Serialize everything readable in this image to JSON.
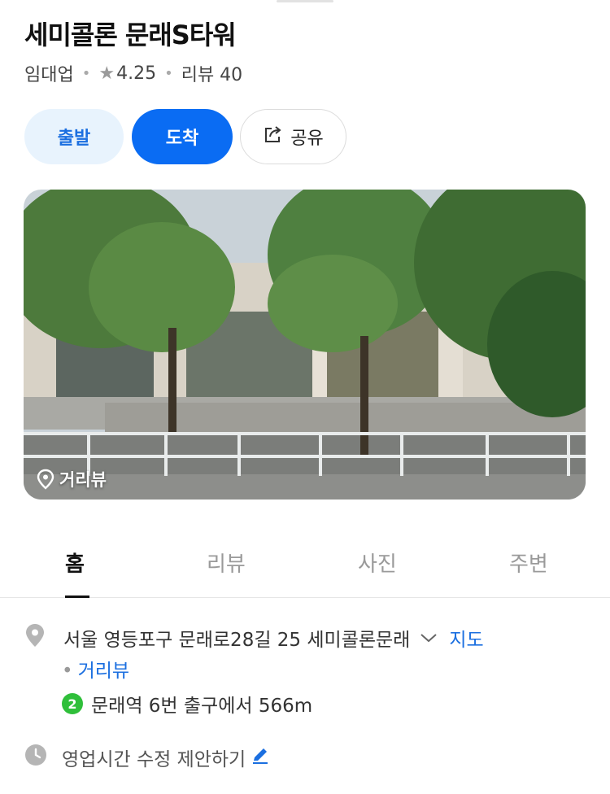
{
  "place": {
    "name": "세미콜론 문래S타워",
    "category": "임대업",
    "rating": "4.25",
    "reviews": "리뷰 40"
  },
  "actions": {
    "depart": "출발",
    "arrive": "도착",
    "share": "공유"
  },
  "photo": {
    "streetview_label": "거리뷰"
  },
  "tabs": [
    "홈",
    "리뷰",
    "사진",
    "주변"
  ],
  "info": {
    "address": "서울 영등포구 문래로28길 25 세미콜론문래",
    "map_link": "지도",
    "streetview_link": "거리뷰",
    "subway_line": "2",
    "subway_text": "문래역 6번 출구에서 566m",
    "hours_suggest": "영업시간 수정 제안하기"
  },
  "colors": {
    "primary": "#0a6cf3",
    "primary_light": "#e8f3fd",
    "line2_green": "#2fbf3a"
  },
  "icons": {
    "share": "share-icon",
    "star": "star-icon",
    "pin": "location-pin-icon",
    "clock": "clock-icon",
    "edit": "pencil-icon",
    "chevron": "chevron-down-icon"
  }
}
